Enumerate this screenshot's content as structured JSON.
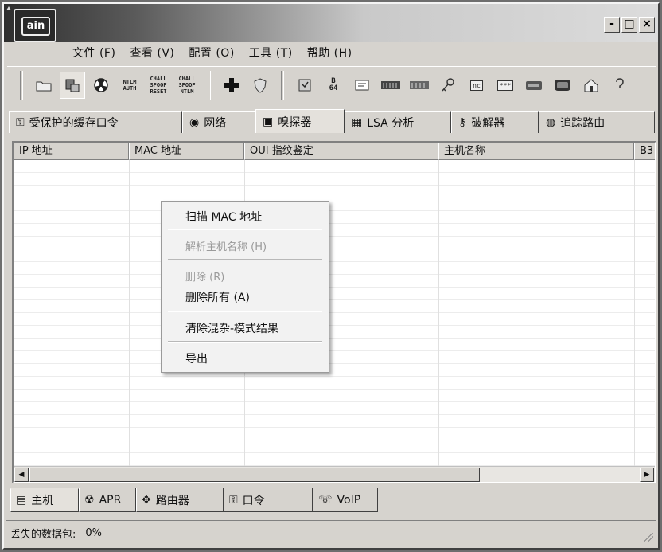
{
  "app": {
    "logo_text": "ain"
  },
  "window_buttons": {
    "minimize": "-",
    "maximize": "□",
    "close": "×"
  },
  "menu": [
    "文件 (F)",
    "查看 (V)",
    "配置 (O)",
    "工具 (T)",
    "帮助 (H)"
  ],
  "toolbar": {
    "ntlm_auth": "NTLM\nAUTH",
    "chall_spoof_reset": "CHALL\nSPOOF\nRESET",
    "chall_spoof_ntlm": "CHALL\nSPOOF\nNTLM",
    "b64": "B\n64",
    "hash_box": "***",
    "nc": "nc"
  },
  "tabs": [
    {
      "label": "受保护的缓存口令",
      "icon": "key-box-icon"
    },
    {
      "label": "网络",
      "icon": "globe-icon"
    },
    {
      "label": "嗅探器",
      "icon": "sniffer-icon"
    },
    {
      "label": "LSA 分析",
      "icon": "lsa-icon"
    },
    {
      "label": "破解器",
      "icon": "cracker-icon"
    },
    {
      "label": "追踪路由",
      "icon": "traceroute-icon"
    }
  ],
  "columns": [
    "IP 地址",
    "MAC 地址",
    "OUI 指纹鉴定",
    "主机名称",
    "B3"
  ],
  "context_menu": {
    "scan_mac": "扫描 MAC 地址",
    "resolve_host": "解析主机名称 (H)",
    "remove": "删除 (R)",
    "remove_all": "删除所有 (A)",
    "clear_promisc": "清除混杂-模式结果",
    "export": "导出"
  },
  "bottom_tabs": [
    {
      "label": "主机",
      "icon": "host-icon"
    },
    {
      "label": "APR",
      "icon": "apr-icon"
    },
    {
      "label": "路由器",
      "icon": "router-icon"
    },
    {
      "label": "口令",
      "icon": "password-icon"
    },
    {
      "label": "VoIP",
      "icon": "voip-icon"
    }
  ],
  "status": {
    "label": "丢失的数据包:",
    "value": "0%"
  }
}
